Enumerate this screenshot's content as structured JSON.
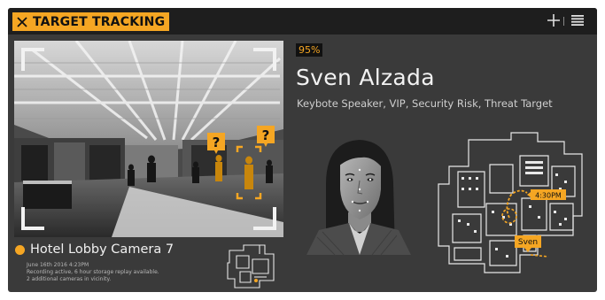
{
  "header": {
    "title": "TARGET TRACKING",
    "close_icon": "close-icon",
    "add_icon": "plus-icon",
    "menu_icon": "hamburger-menu-icon"
  },
  "camera": {
    "name": "Hotel Lobby Camera 7",
    "info_lines": [
      "June 16th 2016 4:23PM",
      "Recording active, 6 hour storage replay available.",
      "2 additional cameras in vicinity."
    ],
    "markers": [
      "?",
      "?"
    ]
  },
  "target": {
    "confidence": "95%",
    "name": "Sven Alzada",
    "tags": "Keybote Speaker, VIP, Security Risk, Threat Target"
  },
  "floorplan": {
    "time_label": "4:30PM",
    "person_label": "Sven"
  },
  "colors": {
    "accent": "#f5a623",
    "panel": "#3a3a3a",
    "header": "#1e1e1e"
  }
}
